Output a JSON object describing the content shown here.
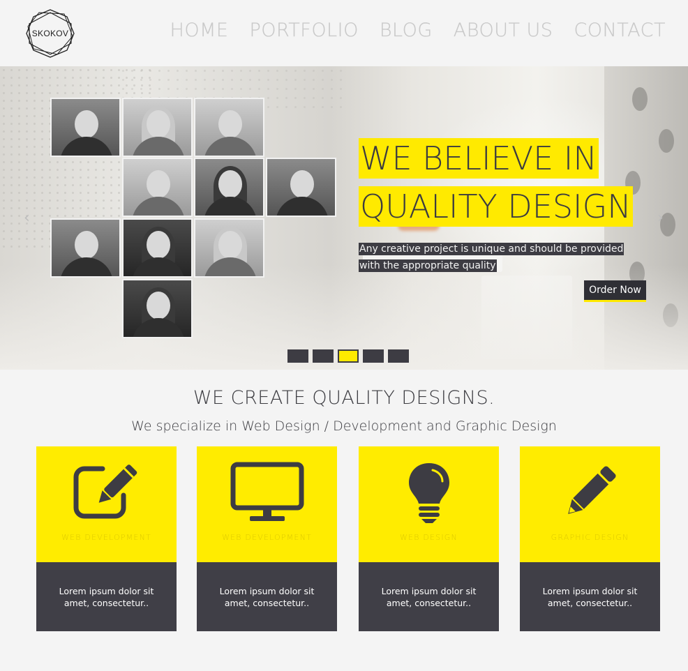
{
  "logo": {
    "text": "SKOKOV"
  },
  "nav": [
    {
      "label": "HOME"
    },
    {
      "label": "PORTFOLIO"
    },
    {
      "label": "BLOG"
    },
    {
      "label": "ABOUT US"
    },
    {
      "label": "CONTACT"
    }
  ],
  "hero": {
    "title_line1": "WE BELIEVE IN",
    "title_line2": "QUALITY DESIGN",
    "sub_line1": "Any creative project is unique and should be provided",
    "sub_line2": "with the appropriate quality",
    "cta_label": "Order Now",
    "prev_arrow": "‹",
    "next_arrow": "›",
    "slides_total": 5,
    "active_slide": 3
  },
  "section": {
    "title": "WE CREATE QUALITY DESIGNS.",
    "subtitle": "We specialize in Web Design / Development and Graphic Design"
  },
  "services": [
    {
      "label": "WEB DEVELOPMENT",
      "text": "Lorem ipsum dolor sit amet, consectetur..",
      "icon": "edit-icon"
    },
    {
      "label": "WEB DEVELOPMENT",
      "text": "Lorem ipsum dolor sit amet, consectetur..",
      "icon": "monitor-icon"
    },
    {
      "label": "WEB DESIGN",
      "text": "Lorem ipsum dolor sit amet, consectetur..",
      "icon": "lightbulb-icon"
    },
    {
      "label": "GRAPHIC DESIGN",
      "text": "Lorem ipsum dolor sit amet, consectetur..",
      "icon": "pencil-icon"
    }
  ],
  "colors": {
    "accent": "#ffea00",
    "dark": "#403f47",
    "background": "#f4f4f4"
  }
}
